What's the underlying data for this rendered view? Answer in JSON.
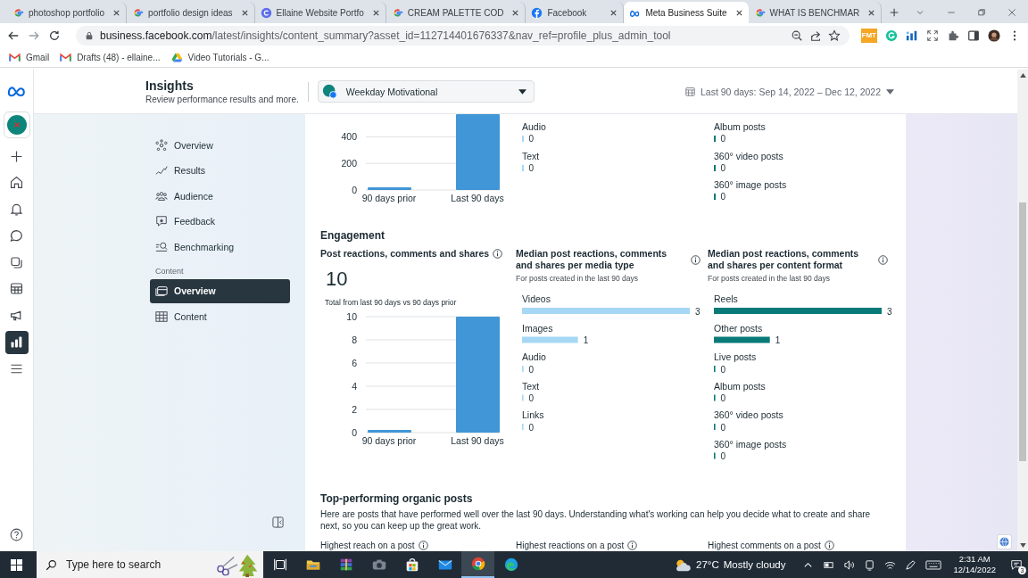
{
  "browser": {
    "tabs": [
      {
        "title": "photoshop portfolio",
        "selected": false
      },
      {
        "title": "portfolio design ideas",
        "selected": false
      },
      {
        "title": "Ellaine Website Portfo",
        "selected": false
      },
      {
        "title": "CREAM PALETTE COD",
        "selected": false
      },
      {
        "title": "Facebook",
        "selected": false
      },
      {
        "title": "Meta Business Suite",
        "selected": true
      },
      {
        "title": "WHAT IS BENCHMAR",
        "selected": false
      }
    ],
    "url": {
      "host": "business.facebook.com",
      "path": "/latest/insights/content_summary?asset_id=112714401676337&nav_ref=profile_plus_admin_tool"
    },
    "extension_label": "FMT",
    "bookmarks": [
      {
        "label": "Gmail"
      },
      {
        "label": "Drafts (48) - ellaine..."
      },
      {
        "label": "Video Tutorials - G..."
      }
    ]
  },
  "rail": [
    {
      "kind": "create",
      "selected": false
    },
    {
      "kind": "home",
      "selected": false
    },
    {
      "kind": "bell",
      "selected": false
    },
    {
      "kind": "chat",
      "selected": false
    },
    {
      "kind": "pages",
      "selected": false
    },
    {
      "kind": "table",
      "selected": false
    },
    {
      "kind": "megaphone",
      "selected": false
    },
    {
      "kind": "insights",
      "selected": true
    },
    {
      "kind": "menu",
      "selected": false
    }
  ],
  "header": {
    "title": "Insights",
    "subtitle": "Review performance results and more.",
    "account": "Weekday Motivational",
    "date_range": "Last 90 days: Sep 14, 2022 – Dec 12, 2022"
  },
  "nav": {
    "items": [
      {
        "label": "Overview",
        "selected": false
      },
      {
        "label": "Results",
        "selected": false
      },
      {
        "label": "Audience",
        "selected": false
      },
      {
        "label": "Feedback",
        "selected": false
      },
      {
        "label": "Benchmarking",
        "selected": false
      }
    ],
    "section_label": "Content",
    "content_items": [
      {
        "label": "Overview",
        "selected": true
      },
      {
        "label": "Content",
        "selected": false
      }
    ]
  },
  "reach": {
    "chart_data": {
      "type": "bar",
      "categories": [
        "90 days prior",
        "Last 90 days"
      ],
      "values": [
        20,
        570
      ],
      "ylim": [
        0,
        570
      ],
      "yticks": [
        0,
        200,
        400
      ],
      "grid": true
    },
    "media_types": [
      {
        "label": "Audio",
        "value": "0"
      },
      {
        "label": "Text",
        "value": "0"
      }
    ],
    "content_formats": [
      {
        "label": "Album posts",
        "value": "0"
      },
      {
        "label": "360° video posts",
        "value": "0"
      },
      {
        "label": "360° image posts",
        "value": "0"
      }
    ]
  },
  "engagement": {
    "title": "Engagement",
    "total": {
      "title": "Post reactions, comments and shares",
      "value": "10",
      "caption": "Total from last 90 days vs 90 days prior",
      "chart_data": {
        "type": "bar",
        "categories": [
          "90 days prior",
          "Last 90 days"
        ],
        "values": [
          0,
          10
        ],
        "ylim": [
          0,
          10
        ],
        "yticks": [
          0,
          2,
          4,
          6,
          8,
          10
        ],
        "grid": true
      }
    },
    "media": {
      "title": "Median post reactions, comments and shares per media type",
      "caption": "For posts created in the last 90 days",
      "chart_data": {
        "type": "bar",
        "orientation": "horizontal",
        "categories": [
          "Videos",
          "Images",
          "Audio",
          "Text",
          "Links"
        ],
        "values": [
          3,
          1,
          0,
          0,
          0
        ],
        "data_labels": true
      }
    },
    "formats": {
      "title": "Median post reactions, comments and shares per content format",
      "caption": "For posts created in the last 90 days",
      "chart_data": {
        "type": "bar",
        "orientation": "horizontal",
        "categories": [
          "Reels",
          "Other posts",
          "Live posts",
          "Album posts",
          "360° video posts",
          "360° image posts"
        ],
        "values": [
          3,
          1,
          0,
          0,
          0,
          0
        ],
        "data_labels": true
      }
    }
  },
  "top_posts": {
    "title": "Top-performing organic posts",
    "description": "Here are posts that have performed well over the last 90 days. Understanding what's working can help you decide what to create and share next, so you can keep up the great work.",
    "columns": [
      "Highest reach on a post",
      "Highest reactions on a post",
      "Highest comments on a post"
    ]
  },
  "taskbar": {
    "search_placeholder": "Type here to search",
    "apps": [
      {
        "kind": "taskview",
        "selected": false
      },
      {
        "kind": "explorer",
        "selected": false
      },
      {
        "kind": "winrar",
        "selected": false
      },
      {
        "kind": "camera",
        "selected": false
      },
      {
        "kind": "store",
        "selected": false
      },
      {
        "kind": "mail",
        "selected": false
      },
      {
        "kind": "chrome",
        "selected": true
      },
      {
        "kind": "edge",
        "selected": false
      }
    ],
    "temperature": "27°C",
    "weather": "Mostly cloudy",
    "time": "2:31 AM",
    "date": "12/14/2022",
    "notifications": "3"
  }
}
